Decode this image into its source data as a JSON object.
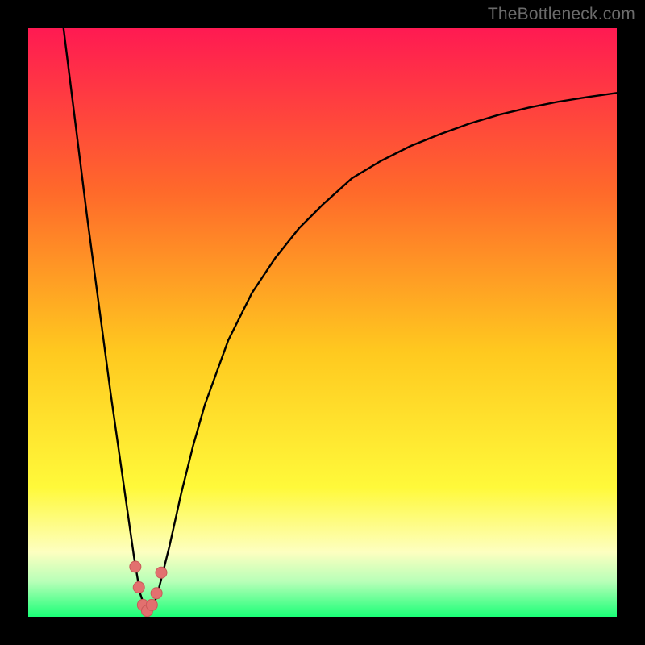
{
  "watermark": "TheBottleneck.com",
  "colors": {
    "frame": "#000000",
    "grad_top": "#ff1a52",
    "grad_mid_upper": "#ff6a2a",
    "grad_mid": "#ffc91f",
    "grad_mid_lower": "#fff93a",
    "grad_pale": "#fdffc0",
    "grad_green_pale": "#b8ffb8",
    "grad_green": "#1aff77",
    "curve": "#000000",
    "marker_fill": "#e2706f",
    "marker_stroke": "#c95a59"
  },
  "chart_data": {
    "type": "line",
    "title": "",
    "xlabel": "",
    "ylabel": "",
    "xlim": [
      0,
      100
    ],
    "ylim": [
      0,
      100
    ],
    "series": [
      {
        "name": "bottleneck-curve",
        "x": [
          6,
          8,
          10,
          12,
          14,
          16,
          18,
          19,
          20,
          21,
          22,
          24,
          26,
          28,
          30,
          34,
          38,
          42,
          46,
          50,
          55,
          60,
          65,
          70,
          75,
          80,
          85,
          90,
          95,
          100
        ],
        "y": [
          100,
          84,
          68,
          53,
          38,
          24,
          10,
          4,
          1,
          1,
          4,
          12,
          21,
          29,
          36,
          47,
          55,
          61,
          66,
          70,
          74.5,
          77.5,
          80,
          82,
          83.8,
          85.3,
          86.5,
          87.5,
          88.3,
          89
        ]
      }
    ],
    "markers": {
      "name": "highlight-points",
      "x": [
        18.2,
        18.8,
        19.5,
        20.2,
        21.0,
        21.8,
        22.6
      ],
      "y": [
        8.5,
        5.0,
        2.0,
        1.0,
        2.0,
        4.0,
        7.5
      ]
    }
  }
}
